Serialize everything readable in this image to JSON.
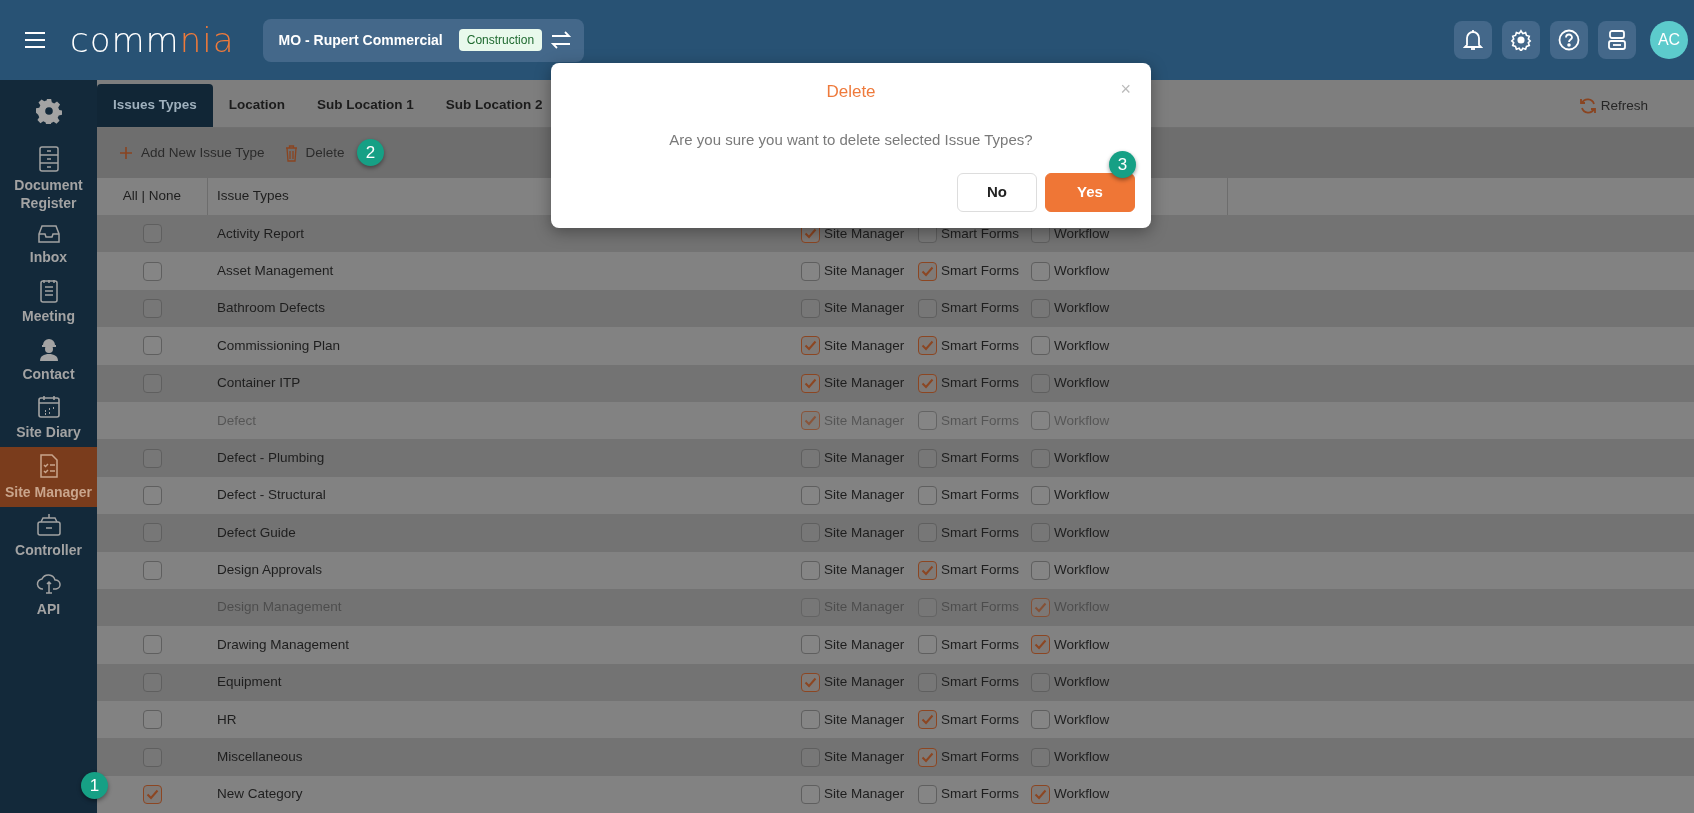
{
  "header": {
    "logo": {
      "primary": "comm",
      "accent": "nia"
    },
    "project": "MO - Rupert Commercial",
    "project_tag": "Construction",
    "avatar": "AC"
  },
  "sidebar": {
    "items": [
      {
        "label": "Document Register",
        "kind": "cabinet",
        "selected": false
      },
      {
        "label": "Inbox",
        "kind": "inbox",
        "selected": false
      },
      {
        "label": "Meeting",
        "kind": "notes",
        "selected": false
      },
      {
        "label": "Contact",
        "kind": "worker",
        "selected": false
      },
      {
        "label": "Site Diary",
        "kind": "calendar",
        "selected": false
      },
      {
        "label": "Site Manager",
        "kind": "checklist",
        "selected": true
      },
      {
        "label": "Controller",
        "kind": "controller",
        "selected": false
      },
      {
        "label": "API",
        "kind": "cloud",
        "selected": false
      }
    ]
  },
  "tabs": [
    {
      "label": "Issues Types",
      "selected": true
    },
    {
      "label": "Location",
      "selected": false
    },
    {
      "label": "Sub Location 1",
      "selected": false
    },
    {
      "label": "Sub Location 2",
      "selected": false
    }
  ],
  "refresh": "Refresh",
  "toolbar": {
    "add": "Add New Issue Type",
    "delete": "Delete",
    "delete_step": "2"
  },
  "table": {
    "columns": [
      "All | None",
      "Issue Types"
    ],
    "rows": [
      {
        "name": "Activity Report",
        "selected": false,
        "disabled": false,
        "flags": [
          {
            "label": "Site Manager",
            "checked": true
          },
          {
            "label": "Smart Forms",
            "checked": false
          },
          {
            "label": "Workflow",
            "checked": false
          }
        ]
      },
      {
        "name": "Asset Management",
        "selected": false,
        "disabled": false,
        "flags": [
          {
            "label": "Site Manager",
            "checked": false
          },
          {
            "label": "Smart Forms",
            "checked": true
          },
          {
            "label": "Workflow",
            "checked": false
          }
        ]
      },
      {
        "name": "Bathroom Defects",
        "selected": false,
        "disabled": false,
        "flags": [
          {
            "label": "Site Manager",
            "checked": false
          },
          {
            "label": "Smart Forms",
            "checked": false
          },
          {
            "label": "Workflow",
            "checked": false
          }
        ]
      },
      {
        "name": "Commissioning Plan",
        "selected": false,
        "disabled": false,
        "flags": [
          {
            "label": "Site Manager",
            "checked": true
          },
          {
            "label": "Smart Forms",
            "checked": true
          },
          {
            "label": "Workflow",
            "checked": false
          }
        ]
      },
      {
        "name": "Container ITP",
        "selected": false,
        "disabled": false,
        "flags": [
          {
            "label": "Site Manager",
            "checked": true
          },
          {
            "label": "Smart Forms",
            "checked": true
          },
          {
            "label": "Workflow",
            "checked": false
          }
        ]
      },
      {
        "name": "Defect",
        "disabled": true,
        "flags": [
          {
            "label": "Site Manager",
            "checked": true
          },
          {
            "label": "Smart Forms",
            "checked": false
          },
          {
            "label": "Workflow",
            "checked": false
          }
        ]
      },
      {
        "name": "Defect - Plumbing",
        "selected": false,
        "disabled": false,
        "flags": [
          {
            "label": "Site Manager",
            "checked": false
          },
          {
            "label": "Smart Forms",
            "checked": false
          },
          {
            "label": "Workflow",
            "checked": false
          }
        ]
      },
      {
        "name": "Defect - Structural",
        "selected": false,
        "disabled": false,
        "flags": [
          {
            "label": "Site Manager",
            "checked": false
          },
          {
            "label": "Smart Forms",
            "checked": false
          },
          {
            "label": "Workflow",
            "checked": false
          }
        ]
      },
      {
        "name": "Defect Guide",
        "selected": false,
        "disabled": false,
        "flags": [
          {
            "label": "Site Manager",
            "checked": false
          },
          {
            "label": "Smart Forms",
            "checked": false
          },
          {
            "label": "Workflow",
            "checked": false
          }
        ]
      },
      {
        "name": "Design Approvals",
        "selected": false,
        "disabled": false,
        "flags": [
          {
            "label": "Site Manager",
            "checked": false
          },
          {
            "label": "Smart Forms",
            "checked": true
          },
          {
            "label": "Workflow",
            "checked": false
          }
        ]
      },
      {
        "name": "Design Management",
        "disabled": true,
        "flags": [
          {
            "label": "Site Manager",
            "checked": false
          },
          {
            "label": "Smart Forms",
            "checked": false
          },
          {
            "label": "Workflow",
            "checked": true
          }
        ]
      },
      {
        "name": "Drawing Management",
        "selected": false,
        "disabled": false,
        "flags": [
          {
            "label": "Site Manager",
            "checked": false
          },
          {
            "label": "Smart Forms",
            "checked": false
          },
          {
            "label": "Workflow",
            "checked": true
          }
        ]
      },
      {
        "name": "Equipment",
        "selected": false,
        "disabled": false,
        "flags": [
          {
            "label": "Site Manager",
            "checked": true
          },
          {
            "label": "Smart Forms",
            "checked": false
          },
          {
            "label": "Workflow",
            "checked": false
          }
        ]
      },
      {
        "name": "HR",
        "selected": false,
        "disabled": false,
        "flags": [
          {
            "label": "Site Manager",
            "checked": false
          },
          {
            "label": "Smart Forms",
            "checked": true
          },
          {
            "label": "Workflow",
            "checked": false
          }
        ]
      },
      {
        "name": "Miscellaneous",
        "selected": false,
        "disabled": false,
        "flags": [
          {
            "label": "Site Manager",
            "checked": false
          },
          {
            "label": "Smart Forms",
            "checked": true
          },
          {
            "label": "Workflow",
            "checked": false
          }
        ]
      },
      {
        "name": "New Category",
        "selected": true,
        "disabled": false,
        "step": "1",
        "flags": [
          {
            "label": "Site Manager",
            "checked": false
          },
          {
            "label": "Smart Forms",
            "checked": false
          },
          {
            "label": "Workflow",
            "checked": true
          }
        ]
      }
    ]
  },
  "dialog": {
    "title": "Delete",
    "close": "×",
    "message": "Are you sure you want to delete selected Issue Types?",
    "buttons": [
      {
        "label": "No",
        "kind": "secondary"
      },
      {
        "label": "Yes",
        "kind": "primary",
        "step": "3"
      }
    ]
  }
}
